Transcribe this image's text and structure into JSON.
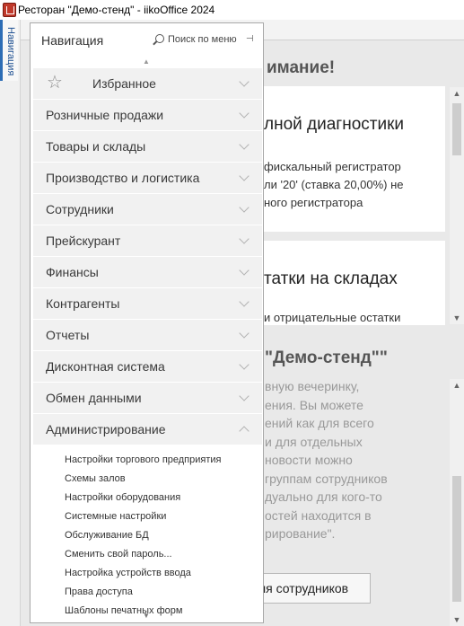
{
  "window": {
    "title": "Ресторан \"Демо-стенд\" - iikoOffice 2024"
  },
  "side_tab": {
    "label": "Навигация"
  },
  "nav": {
    "title": "Навигация",
    "search_label": "Поиск по меню",
    "sections": [
      {
        "label": "Избранное",
        "icon": "star-icon",
        "expanded": false
      },
      {
        "label": "Розничные продажи",
        "expanded": false
      },
      {
        "label": "Товары и склады",
        "expanded": false
      },
      {
        "label": "Производство и логистика",
        "expanded": false
      },
      {
        "label": "Сотрудники",
        "expanded": false
      },
      {
        "label": "Прейскурант",
        "expanded": false
      },
      {
        "label": "Финансы",
        "expanded": false
      },
      {
        "label": "Контрагенты",
        "expanded": false
      },
      {
        "label": "Отчеты",
        "expanded": false
      },
      {
        "label": "Дисконтная система",
        "expanded": false
      },
      {
        "label": "Обмен данными",
        "expanded": false
      },
      {
        "label": "Администрирование",
        "expanded": true
      }
    ],
    "admin_items": [
      "Настройки торгового предприятия",
      "Схемы залов",
      "Настройки оборудования",
      "Системные настройки",
      "Обслуживание БД",
      "Сменить свой пароль...",
      "Настройка устройств ввода",
      "Права доступа",
      "Шаблоны печатных форм"
    ]
  },
  "background": {
    "attention": "имание!",
    "card1_title": "лной диагностики",
    "card1_lines": [
      "фискальный регистратор",
      "ли '20' (ставка 20,00%) не",
      "ного регистратора"
    ],
    "card2_title": "татки на складах",
    "card2_text": "и отрицательные остатки",
    "demo_title": "\"Демо-стенд\"\"",
    "demo_lines": [
      "вную вечеринку,",
      "ения. Вы можете",
      "ений как для всего",
      "и для отдельных",
      "новости можно",
      "группам сотрудников",
      "дуально для кого-то",
      "остей находится в",
      "рирование\"."
    ],
    "employee_button": "ля сотрудников"
  },
  "colors": {
    "accent": "#2d6db5",
    "section_bg": "#f1f1f1",
    "panel_border": "#a9a9a9"
  }
}
